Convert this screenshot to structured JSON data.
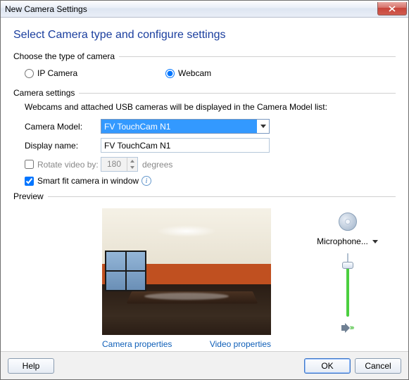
{
  "window": {
    "title": "New Camera Settings"
  },
  "heading": "Select Camera type and configure settings",
  "typeGroup": {
    "label": "Choose the type of camera",
    "ip": "IP Camera",
    "webcam": "Webcam",
    "selected": "webcam"
  },
  "settingsGroup": {
    "label": "Camera settings",
    "hint": "Webcams and attached USB cameras will be displayed in the Camera Model list:",
    "modelLabel": "Camera Model:",
    "modelValue": "FV TouchCam N1",
    "displayLabel": "Display name:",
    "displayValue": "FV TouchCam N1",
    "rotateLabel": "Rotate video by:",
    "rotateValue": "180",
    "degrees": "degrees",
    "smartFitLabel": "Smart fit camera in window"
  },
  "previewGroup": {
    "label": "Preview",
    "cameraProps": "Camera properties",
    "videoProps": "Video properties",
    "micLabel": "Microphone..."
  },
  "footer": {
    "help": "Help",
    "ok": "OK",
    "cancel": "Cancel"
  }
}
